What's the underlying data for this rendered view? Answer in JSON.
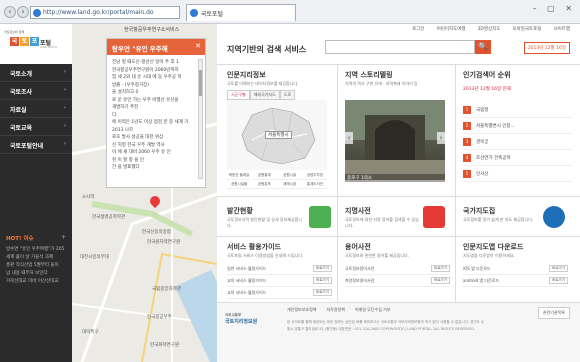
{
  "browser": {
    "url": "http://www.land.go.kr/portal/main.do",
    "tab_title": "국토포털",
    "window_controls": "– ▢ ✕"
  },
  "sidebar": {
    "logo_small": "국토정보와 함께",
    "logo_chars": [
      "국",
      "토",
      "포"
    ],
    "logo_name": "포털",
    "logo_en": "LAND PORTAL",
    "items": [
      {
        "label": "국토소개"
      },
      {
        "label": "국토조사"
      },
      {
        "label": "자료실"
      },
      {
        "label": "국토교육"
      },
      {
        "label": "국토포털안내"
      }
    ],
    "hot_title": "HOT! 이슈",
    "hot_plus": "+",
    "hot_lines": [
      "방수연 \"유인 우주여행\"가 205",
      "세계 홀이 날 가을석 과제",
      "총판 작식산업 5월부터 들이",
      "넘 내용 때부처 보인다",
      "거북선대교 미바 이산선대교"
    ]
  },
  "map": {
    "top_label": "한국항공우주연구소서비스",
    "popup_title": "탐우연 \"유인 우주해",
    "popup_close": "✕",
    "popup_lines": [
      "전남 힐 때도신-항산선 일어 주 후 1",
      "한국항공우주연구원이 2060년까지",
      "힘 세 2와 대 유 시대 에 동 우주공 학",
      "방출 - (우주정거장)",
      "을 설치하고 0",
      "로 운 유인 가는 우주 비행선 유선을",
      "개발하기 추진",
      "다.",
      "에 이력은 1년도 이상 점검 분 중 세계 기 2013 나르",
      "로호 발사 성공을 대한 위상",
      "신 지정 한국 우주 개발 역사",
      "이 에 새 대비 2060 우주 유 인",
      "천 이 할 항 을 인",
      "간 을 발표했다"
    ],
    "labels": [
      "소사역",
      "한국생명공학학관",
      "한국신동의중합",
      "한국원자력연구원",
      "대전시민의무대",
      "국립중앙과학관",
      "한국항공우주",
      "대덕특구",
      "한국화학연구원"
    ]
  },
  "main": {
    "topnav": [
      "로그인",
      "어린이지도여행",
      "3D영상지도",
      "모바일국토포털",
      "사이트맵"
    ],
    "search_title": "지역기반의 검색 서비스",
    "search_placeholder": "",
    "search_button": "🔍",
    "date_badge": "2013년 12월 16일",
    "panel1": {
      "title": "인문지리정보",
      "desc": "국토를 이해하는 데이터정보를 제공합니다.",
      "subtabs": [
        "시군구별",
        "해외국가지도",
        "도로"
      ],
      "map_label": "서울특별시",
      "gu": [
        "북한산 둘레길",
        "공원통계",
        "공원시설",
        "공영주차장",
        "공원시설물",
        "공원분포",
        "재래시장",
        "통계도서관"
      ]
    },
    "panel2": {
      "title": "지역 스토리텔링",
      "desc": "지역의 역사 구한 유래 · 지역축제 이야기 등",
      "caption": "종로구 1의소"
    },
    "panel3": {
      "title": "인기검색어 순위",
      "date": "2013년 12월 16일 현재",
      "ranks": [
        {
          "n": "1",
          "text": "국립정"
        },
        {
          "n": "2",
          "text": "서울특별변시 인창..."
        },
        {
          "n": "3",
          "text": "경북궁"
        },
        {
          "n": "4",
          "text": "조선연가 건축공학"
        },
        {
          "n": "5",
          "text": "인사산"
        }
      ]
    },
    "row2": [
      {
        "title": "발간현황",
        "desc": "국토정보서적 발간현황 및 상세 정보제공합니다.",
        "color": "#4caf50"
      },
      {
        "title": "지명사전",
        "desc": "국토정보에 대한 지명 용어를 검색할 수 있습니다.",
        "color": "#e53935"
      },
      {
        "title": "국가지도집",
        "desc": "국토정보를 알기 쉽게 한 지도 제공합니다.",
        "color": "#1e6fb8"
      }
    ],
    "row3": [
      {
        "title": "서비스 활용가이드",
        "desc": "국토포털 서비스 이용방법을 안내해 드립니다.",
        "rows": [
          [
            "일반 서비스 활용가이드",
            "바로가기"
          ],
          [
            "교육 서비스 활용가이드",
            "바로가기"
          ],
          [
            "교육 서비스 활용가이드",
            "바로가기"
          ]
        ]
      },
      {
        "title": "용어사전",
        "desc": "국토정보와 관련한 용어를 제공합니다.",
        "rows": [
          [
            "국토정보용어사전",
            "바로가기"
          ],
          [
            "측량정보용어사전",
            "바로가기"
          ]
        ]
      },
      {
        "title": "인문지도앱 다운로드",
        "desc": "지도앱을 다운받아 이용하세요.",
        "rows": [
          [
            "iOS 앱 다운로드",
            "바로가기"
          ],
          [
            "android 앱 다운로드",
            "바로가기"
          ]
        ]
      }
    ],
    "footer": {
      "logo_small": "국토교통부",
      "logo": "국토지리정보원",
      "links": [
        "개인정보보호정책",
        "저작권정책",
        "이메일 무단수집 거부"
      ],
      "copy": "본 사이트를 통해 제공되는 모든 정보는 승인된 바를 제외하고는 국토교통부 국토지리정보원의 허가 없이 사용할 수 없습니다. 경기도 수원시 영통구 월드컵로 92 (원천동) 대표번호 : 031-210-2600 COPYRIGHT(C) LAND PORTAL. ALL RIGHTS RESERVED.",
      "family": "관련기관목록"
    }
  }
}
